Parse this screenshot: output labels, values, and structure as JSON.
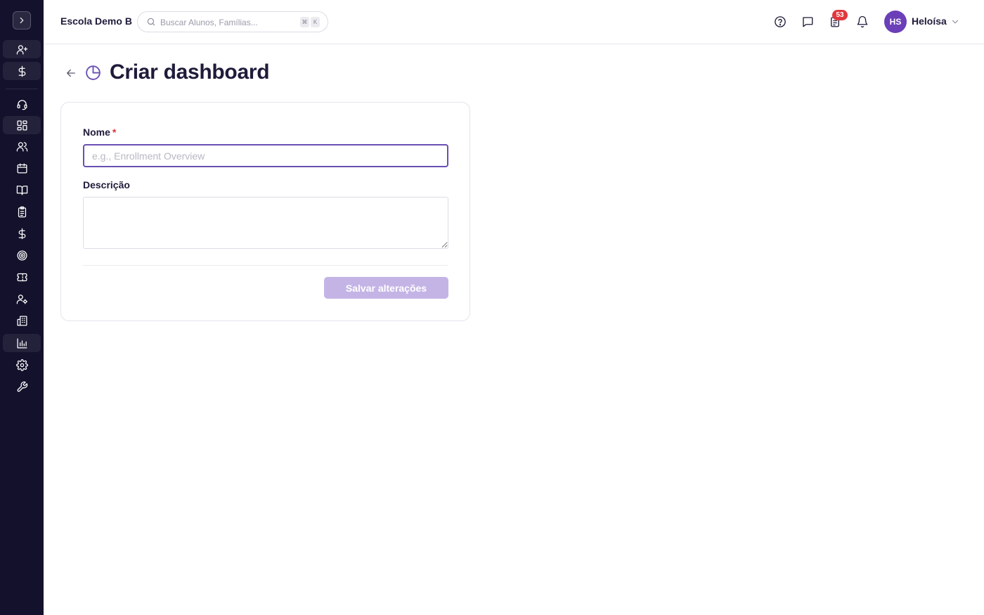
{
  "header": {
    "school_name": "Escola Demo B",
    "search": {
      "placeholder": "Buscar Alunos, Famílias...",
      "value": "",
      "shortcut": [
        "⌘",
        "K"
      ]
    },
    "notification_badge": "53",
    "user": {
      "initials": "HS",
      "name": "Heloísa"
    }
  },
  "sidebar": {
    "items": [
      {
        "name": "sidebar-item-add-user",
        "icon": "user-plus-icon"
      },
      {
        "name": "sidebar-item-finance-top",
        "icon": "dollar-icon"
      },
      {
        "name": "sidebar-item-support",
        "icon": "headset-icon"
      },
      {
        "name": "sidebar-item-dashboard",
        "icon": "dashboard-icon"
      },
      {
        "name": "sidebar-item-users",
        "icon": "users-icon"
      },
      {
        "name": "sidebar-item-calendar",
        "icon": "calendar-icon"
      },
      {
        "name": "sidebar-item-book",
        "icon": "book-icon"
      },
      {
        "name": "sidebar-item-clipboard",
        "icon": "clipboard-icon"
      },
      {
        "name": "sidebar-item-finance",
        "icon": "dollar-icon"
      },
      {
        "name": "sidebar-item-target",
        "icon": "target-icon"
      },
      {
        "name": "sidebar-item-ticket",
        "icon": "ticket-icon"
      },
      {
        "name": "sidebar-item-user-settings",
        "icon": "user-gear-icon"
      },
      {
        "name": "sidebar-item-building",
        "icon": "building-icon"
      },
      {
        "name": "sidebar-item-reports",
        "icon": "bar-chart-icon"
      },
      {
        "name": "sidebar-item-settings",
        "icon": "gear-icon"
      },
      {
        "name": "sidebar-item-tools",
        "icon": "wrench-icon"
      }
    ]
  },
  "page": {
    "title": "Criar dashboard",
    "form": {
      "name_label": "Nome",
      "required_marker": "*",
      "name_placeholder": "e.g., Enrollment Overview",
      "name_value": "",
      "description_label": "Descrição",
      "description_value": "",
      "save_label": "Salvar alterações"
    }
  },
  "colors": {
    "sidebar_bg": "#13112b",
    "accent": "#6a4fb3",
    "avatar": "#6b3fb8",
    "badge": "#e0383e",
    "save_disabled": "#c4b4e6"
  }
}
